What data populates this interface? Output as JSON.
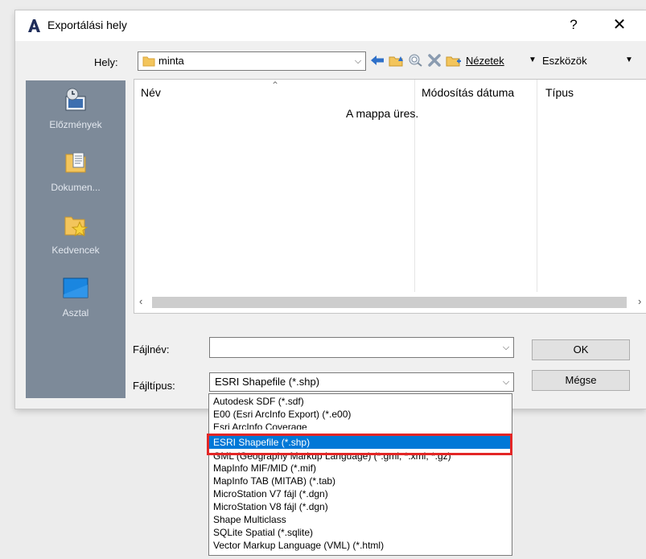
{
  "window": {
    "title": "Exportálási hely",
    "help_label": "?",
    "close_label": "✕"
  },
  "location": {
    "label": "Hely:",
    "value": "minta",
    "views_label": "Nézetek",
    "tools_label": "Eszközök"
  },
  "places": [
    {
      "label": "Előzmények",
      "icon": "history-icon"
    },
    {
      "label": "Dokumen...",
      "icon": "documents-icon"
    },
    {
      "label": "Kedvencek",
      "icon": "favorites-icon"
    },
    {
      "label": "Asztal",
      "icon": "desktop-icon"
    }
  ],
  "filelist": {
    "columns": [
      "Név",
      "Módosítás dátuma",
      "Típus"
    ],
    "empty_text": "A mappa üres."
  },
  "filename": {
    "label": "Fájlnév:",
    "value": ""
  },
  "filetype": {
    "label": "Fájltípus:",
    "value": "ESRI Shapefile  (*.shp)"
  },
  "buttons": {
    "ok": "OK",
    "cancel": "Mégse"
  },
  "filetype_options": [
    "Autodesk SDF (*.sdf)",
    "E00 (Esri ArcInfo Export) (*.e00)",
    "Esri ArcInfo Coverage",
    "ESRI Shapefile  (*.shp)",
    "GML (Geography Markup Language) (*.gml; *.xml; *.gz)",
    "MapInfo MIF/MID (*.mif)",
    "MapInfo TAB (MITAB) (*.tab)",
    "MicroStation V7 fájl (*.dgn)",
    "MicroStation V8 fájl (*.dgn)",
    "Shape Multiclass",
    "SQLite Spatial  (*.sqlite)",
    "Vector Markup Language (VML) (*.html)"
  ],
  "selected_option_index": 3,
  "colors": {
    "accent": "#0078d7",
    "highlight_border": "#e32626",
    "places_bg": "#7d8a99"
  }
}
